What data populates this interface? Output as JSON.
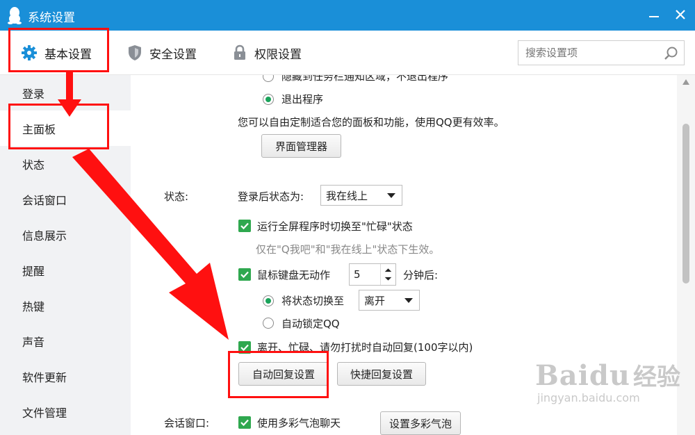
{
  "window": {
    "title": "系统设置"
  },
  "tabs": [
    {
      "label": "基本设置",
      "icon": "gear-icon"
    },
    {
      "label": "安全设置",
      "icon": "shield-icon"
    },
    {
      "label": "权限设置",
      "icon": "lock-icon"
    }
  ],
  "search": {
    "placeholder": "搜索设置项"
  },
  "sidebar": {
    "items": [
      {
        "label": "登录"
      },
      {
        "label": "主面板"
      },
      {
        "label": "状态"
      },
      {
        "label": "会话窗口"
      },
      {
        "label": "信息展示"
      },
      {
        "label": "提醒"
      },
      {
        "label": "热键"
      },
      {
        "label": "声音"
      },
      {
        "label": "软件更新"
      },
      {
        "label": "文件管理"
      }
    ],
    "active": "主面板"
  },
  "main": {
    "close_options": {
      "hide_partial": "隐藏到任务栏通知区域，不退出程序",
      "exit": "退出程序"
    },
    "panel_desc": "您可以自由定制适合您的面板和功能，使用QQ更有效率。",
    "ui_manager_button": "界面管理器",
    "status": {
      "section_label": "状态:",
      "after_login_label": "登录后状态为:",
      "after_login_value": "我在线上",
      "fullscreen_busy_label": "运行全屏程序时切换至\"忙碌\"状态",
      "fullscreen_hint": "仅在\"Q我吧\"和\"我在线上\"状态下生效。",
      "idle_label": "鼠标键盘无动作",
      "idle_minutes": "5",
      "idle_suffix": "分钟后:",
      "switch_status_label": "将状态切换至",
      "switch_status_value": "离开",
      "auto_lock_label": "自动锁定QQ",
      "auto_reply_label": "离开、忙碌、请勿打扰时自动回复(100字以内)",
      "auto_reply_button": "自动回复设置",
      "quick_reply_button": "快捷回复设置"
    },
    "chat_window": {
      "section_label": "会话窗口:",
      "bubble_label": "使用多彩气泡聊天",
      "bubble_button": "设置多彩气泡"
    }
  },
  "watermark": {
    "brand": "Baidu",
    "cn": "经验",
    "url": "jingyan.baidu.com"
  },
  "colors": {
    "titlebar": "#1a8fd8",
    "annotation": "#ff1010",
    "check": "#2fa84f",
    "radio_on": "#1aa35a"
  }
}
